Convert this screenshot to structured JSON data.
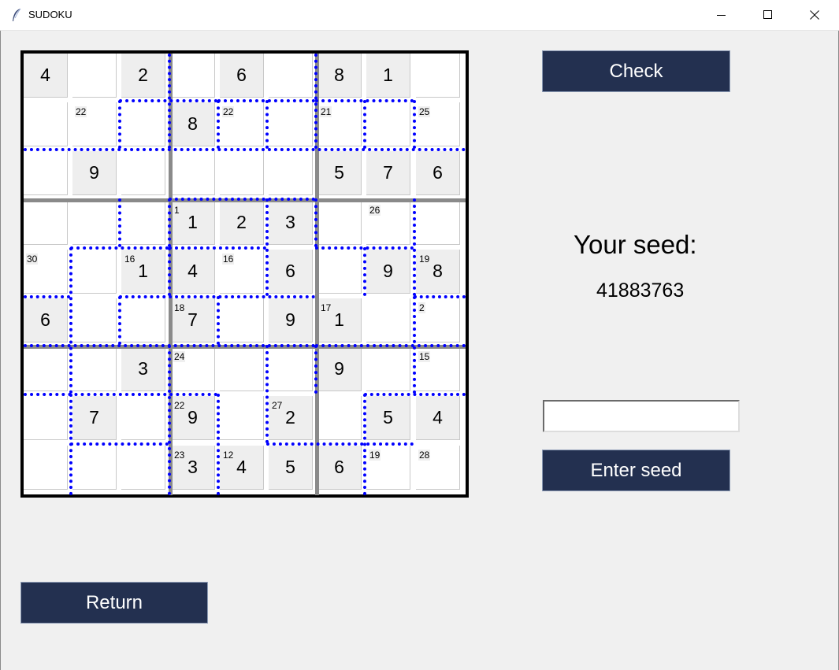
{
  "window": {
    "title": "SUDOKU",
    "app_icon": "feather-icon",
    "controls": [
      "minimize-icon",
      "maximize-icon",
      "close-icon"
    ]
  },
  "colors": {
    "button_bg": "#233050",
    "cage_line": "#0000ff",
    "box_line": "#8a8a8a",
    "given_cell_bg": "#eeeeee"
  },
  "board": {
    "values": [
      [
        "4",
        "",
        "2",
        "",
        "6",
        "",
        "8",
        "1",
        ""
      ],
      [
        "",
        "",
        "",
        "8",
        "",
        "",
        "",
        "",
        ""
      ],
      [
        "",
        "9",
        "",
        "",
        "",
        "",
        "5",
        "7",
        "6"
      ],
      [
        "",
        "",
        "",
        "1",
        "2",
        "3",
        "",
        "",
        ""
      ],
      [
        "",
        "",
        "1",
        "4",
        "",
        "6",
        "",
        "9",
        "8"
      ],
      [
        "6",
        "",
        "",
        "7",
        "",
        "9",
        "1",
        "",
        ""
      ],
      [
        "",
        "",
        "3",
        "",
        "",
        "",
        "9",
        "",
        ""
      ],
      [
        "",
        "7",
        "",
        "9",
        "",
        "2",
        "",
        "5",
        "4"
      ],
      [
        "",
        "",
        "",
        "3",
        "4",
        "5",
        "6",
        "",
        ""
      ]
    ],
    "givens": [
      [
        1,
        0,
        1,
        0,
        1,
        0,
        1,
        1,
        0
      ],
      [
        0,
        0,
        0,
        1,
        0,
        0,
        0,
        0,
        0
      ],
      [
        0,
        1,
        0,
        0,
        0,
        0,
        1,
        1,
        1
      ],
      [
        0,
        0,
        0,
        1,
        1,
        1,
        0,
        0,
        0
      ],
      [
        0,
        0,
        1,
        1,
        0,
        1,
        0,
        1,
        1
      ],
      [
        1,
        0,
        0,
        1,
        0,
        1,
        1,
        0,
        0
      ],
      [
        0,
        0,
        1,
        0,
        0,
        0,
        1,
        0,
        0
      ],
      [
        0,
        1,
        0,
        1,
        0,
        1,
        0,
        1,
        1
      ],
      [
        0,
        0,
        0,
        1,
        1,
        1,
        1,
        0,
        0
      ]
    ],
    "cage_sums": [
      [
        "",
        "",
        "",
        "",
        "",
        "",
        "",
        "",
        ""
      ],
      [
        "",
        "22",
        "",
        "",
        "22",
        "",
        "21",
        "",
        "25"
      ],
      [
        "",
        "",
        "",
        "",
        "",
        "",
        "",
        "",
        ""
      ],
      [
        "",
        "",
        "",
        "1",
        "",
        "",
        "",
        "26",
        ""
      ],
      [
        "30",
        "",
        "16",
        "",
        "16",
        "",
        "",
        "",
        "19"
      ],
      [
        "",
        "",
        "",
        "18",
        "",
        "",
        "17",
        "",
        "2"
      ],
      [
        "",
        "",
        "",
        "24",
        "",
        "",
        "",
        "",
        "15"
      ],
      [
        "",
        "",
        "",
        "22",
        "",
        "27",
        "",
        "",
        ""
      ],
      [
        "",
        "",
        "",
        "23",
        "12",
        "",
        "",
        "19",
        "28"
      ]
    ]
  },
  "buttons": {
    "check": "Check",
    "enter_seed": "Enter seed",
    "return": "Return"
  },
  "seed": {
    "label": "Your seed:",
    "value": "41883763",
    "input_value": ""
  }
}
